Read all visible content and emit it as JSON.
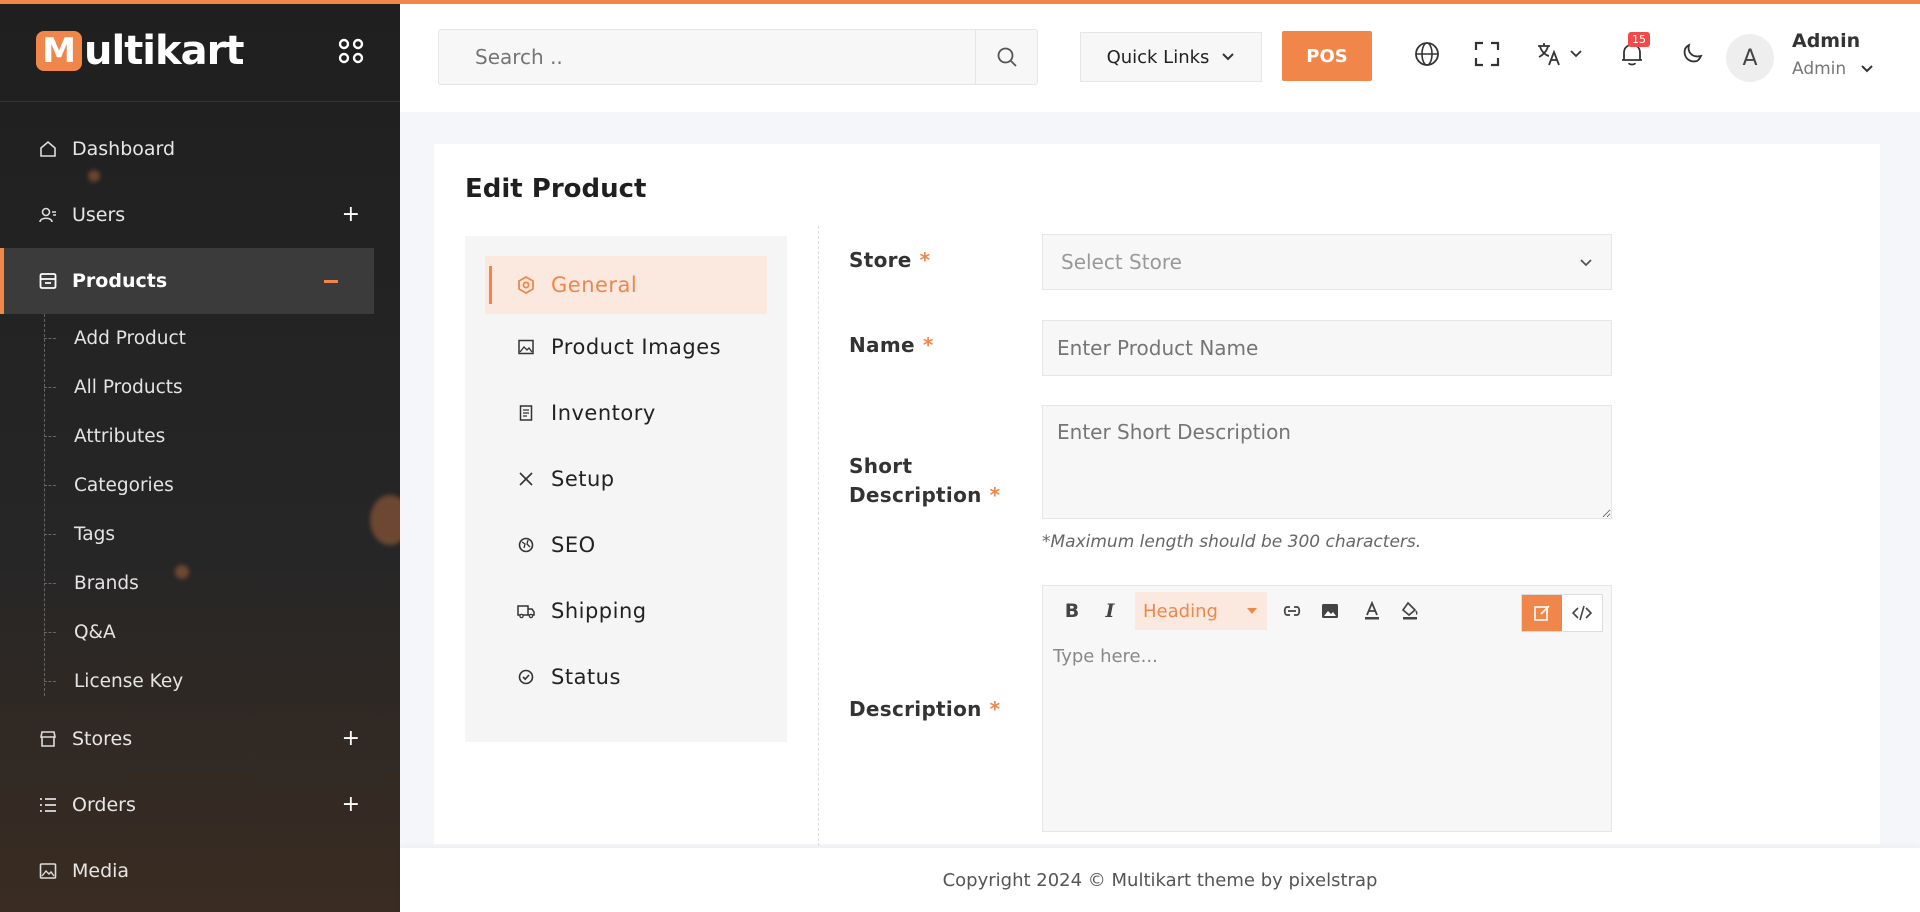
{
  "brand": {
    "logo_letter": "M",
    "name": "ultikart",
    "accent": "#f0864a"
  },
  "sidebar": {
    "items": [
      {
        "label": "Dashboard",
        "icon": "home-icon"
      },
      {
        "label": "Users",
        "icon": "users-icon"
      },
      {
        "label": "Products",
        "icon": "products-icon"
      },
      {
        "label": "Stores",
        "icon": "store-icon"
      },
      {
        "label": "Orders",
        "icon": "orders-icon"
      },
      {
        "label": "Media",
        "icon": "image-icon"
      }
    ],
    "products_sub": [
      "Add Product",
      "All Products",
      "Attributes",
      "Categories",
      "Tags",
      "Brands",
      "Q&A",
      "License Key"
    ]
  },
  "header": {
    "search_placeholder": "Search ..",
    "quick_links": "Quick Links",
    "pos": "POS",
    "notifications_count": "15",
    "avatar_initial": "A",
    "user_name": "Admin",
    "user_role": "Admin"
  },
  "page": {
    "title": "Edit Product",
    "tabs": [
      "General",
      "Product Images",
      "Inventory",
      "Setup",
      "SEO",
      "Shipping",
      "Status"
    ],
    "fields": {
      "store_label": "Store",
      "store_placeholder": "Select Store",
      "name_label": "Name",
      "name_placeholder": "Enter Product Name",
      "short_desc_label_1": "Short",
      "short_desc_label_2": "Description",
      "short_desc_placeholder": "Enter Short Description",
      "short_desc_hint": "*Maximum length should be 300 characters.",
      "desc_label": "Description",
      "required_mark": "*",
      "heading_select": "Heading",
      "editor_placeholder": "Type here..."
    }
  },
  "footer": {
    "text": "Copyright 2024 © Multikart theme by pixelstrap"
  }
}
